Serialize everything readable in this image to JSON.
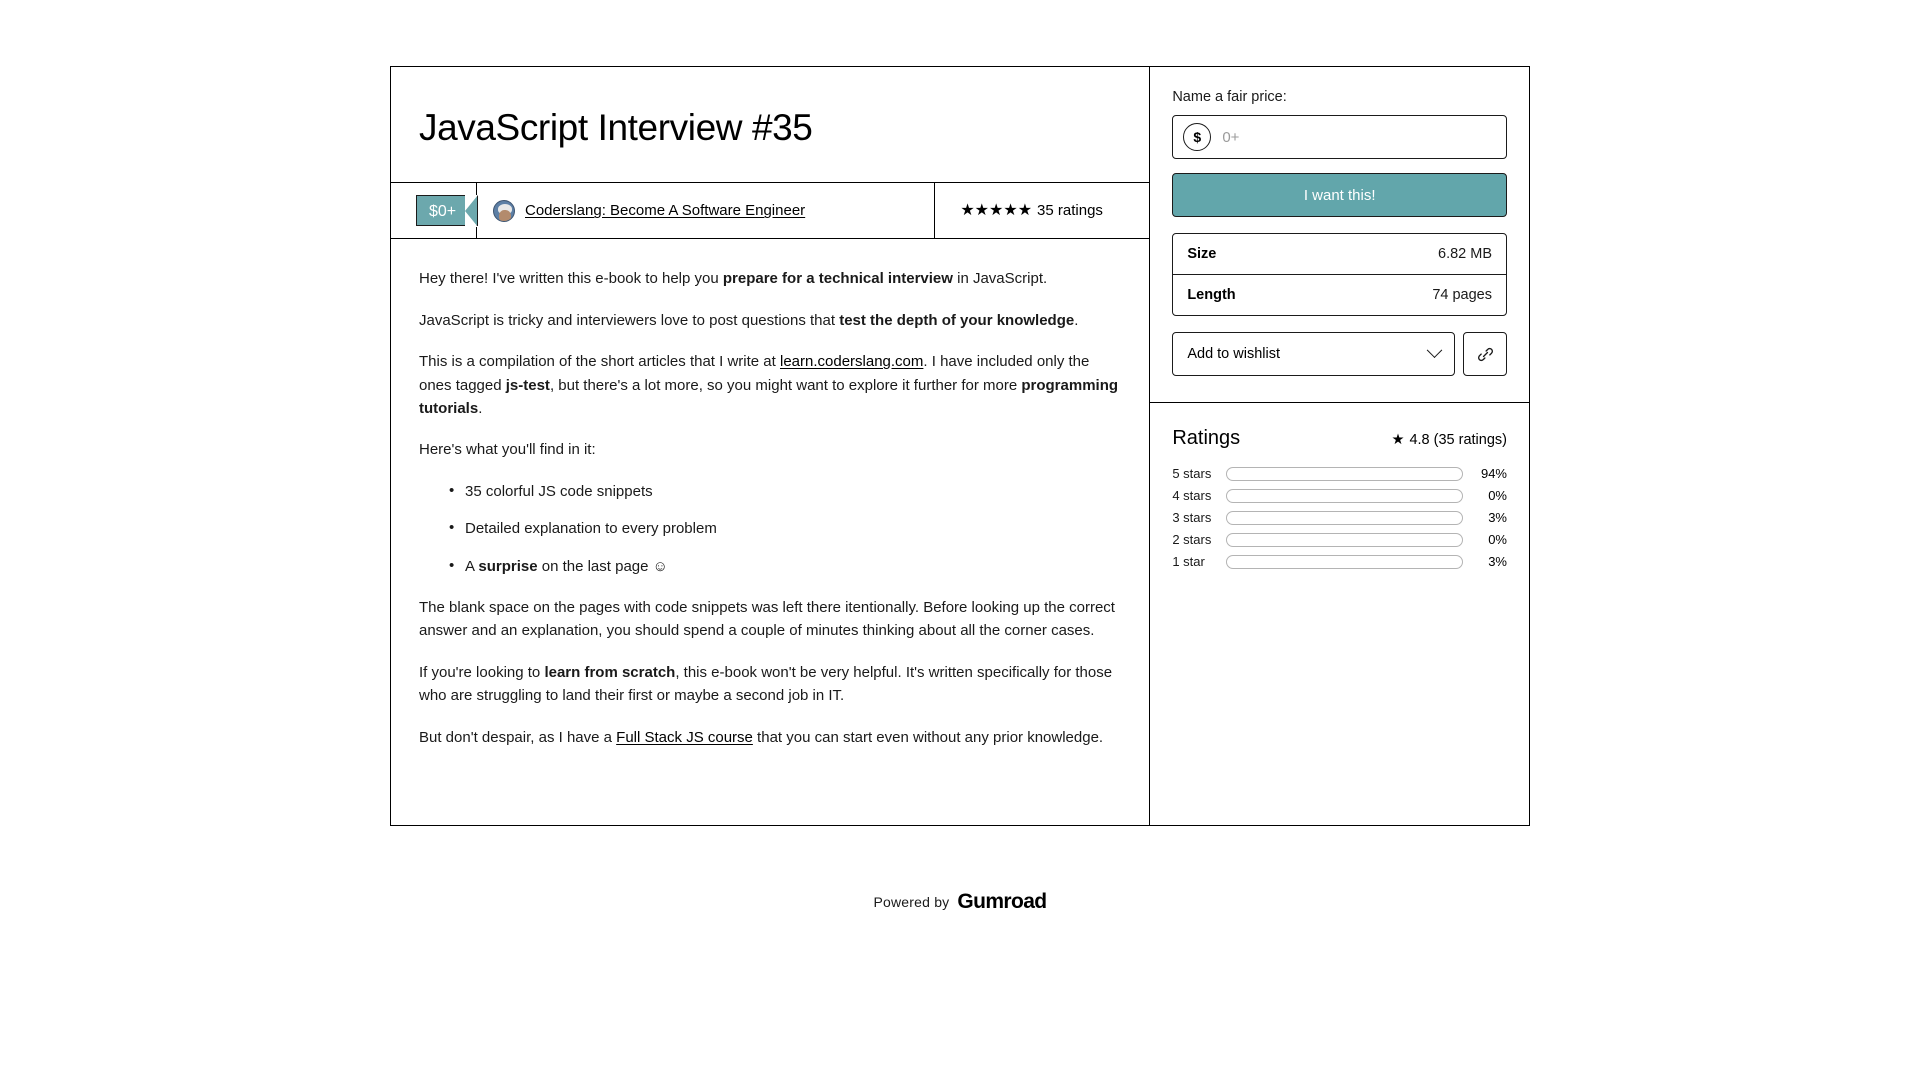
{
  "product": {
    "title": "JavaScript Interview #35",
    "price_tag": "$0+",
    "author": "Coderslang: Become A Software Engineer",
    "stars_glyphs": "★★★★★",
    "ratings_count_label": "35 ratings"
  },
  "description": {
    "p1_a": "Hey there! I've written this e-book to help you ",
    "p1_b": "prepare for a technical interview",
    "p1_c": " in JavaScript.",
    "p2_a": "JavaScript is tricky and interviewers love to post questions that ",
    "p2_b": "test the depth of your knowledge",
    "p2_c": ".",
    "p3_a": "This is a compilation of the short articles that I write at ",
    "p3_link": "learn.coderslang.com",
    "p3_b": ". I have included only the ones tagged ",
    "p3_bold1": "js-test",
    "p3_c": ", but there's a lot more, so you might want to explore it further for more ",
    "p3_bold2": "programming tutorials",
    "p3_d": ".",
    "intro_list": "Here's what you'll find in it:",
    "bullet1": "35 colorful JS code snippets",
    "bullet2": "Detailed explanation to every problem",
    "bullet3_a": "A ",
    "bullet3_bold": "surprise",
    "bullet3_b": " on the last page ☺",
    "p4": "The blank space on the pages with code snippets was left there itentionally. Before looking up the correct answer and an explanation, you should spend a couple of minutes thinking about all the corner cases.",
    "p5_a": "If you're looking to ",
    "p5_bold": "learn from scratch",
    "p5_b": ", this e-book won't be very helpful. It's written specifically for those who are struggling to land their first or maybe a second job in IT.",
    "p6_a": "But don't despair, as I have a ",
    "p6_link": "Full Stack JS course",
    "p6_b": " that you can start even without any prior knowledge."
  },
  "purchase": {
    "price_label": "Name a fair price:",
    "currency_symbol": "$",
    "price_placeholder": "0+",
    "cta_label": "I want this!",
    "attributes": [
      {
        "key": "Size",
        "value": "6.82 MB"
      },
      {
        "key": "Length",
        "value": "74 pages"
      }
    ],
    "wishlist_label": "Add to wishlist",
    "share_icon": "link-icon"
  },
  "ratings": {
    "title": "Ratings",
    "average": "4.8",
    "summary": "4.8 (35 ratings)",
    "star_glyph": "★",
    "breakdown": [
      {
        "label": "5 stars",
        "percent": 94,
        "percent_label": "94%"
      },
      {
        "label": "4 stars",
        "percent": 0,
        "percent_label": "0%"
      },
      {
        "label": "3 stars",
        "percent": 3,
        "percent_label": "3%"
      },
      {
        "label": "2 stars",
        "percent": 0,
        "percent_label": "0%"
      },
      {
        "label": "1 star",
        "percent": 3,
        "percent_label": "3%"
      }
    ]
  },
  "footer": {
    "powered_by": "Powered by",
    "brand": "Gumroad"
  },
  "colors": {
    "accent": "#62a6ab",
    "tag": "#6ca8ad",
    "border": "#1b1b1b"
  }
}
